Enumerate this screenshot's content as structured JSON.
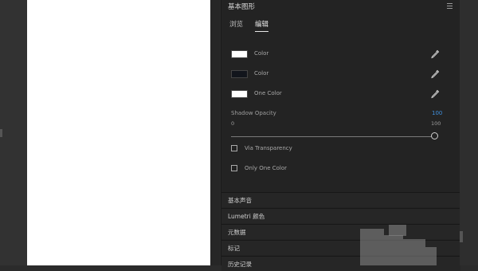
{
  "panel": {
    "title": "基本图形",
    "menu_icon": "hamburger-menu-icon"
  },
  "tabs": [
    {
      "label": "浏览",
      "active": false
    },
    {
      "label": "编辑",
      "active": true
    }
  ],
  "color_rows": [
    {
      "label": "Color",
      "swatch": "#ffffff",
      "icon": "eyedropper-icon"
    },
    {
      "label": "Color",
      "swatch": "#12151c",
      "icon": "eyedropper-icon"
    },
    {
      "label": "One Color",
      "swatch": "#ffffff",
      "icon": "eyedropper-icon"
    }
  ],
  "shadow_opacity": {
    "label": "Shadow Opacity",
    "value": "100",
    "min": "0",
    "max": "100",
    "level": 1.0
  },
  "checkboxes": [
    {
      "label": "Via Transparency",
      "checked": false
    },
    {
      "label": "Only One Color",
      "checked": false
    }
  ],
  "sections": [
    {
      "label": "基本声音"
    },
    {
      "label": "Lumetri 颜色"
    },
    {
      "label": "元数据"
    },
    {
      "label": "标记"
    },
    {
      "label": "历史记录"
    }
  ],
  "colors": {
    "accent_blue": "#3f8fdc",
    "panel_bg": "#232323",
    "canvas_bg": "#ffffff"
  }
}
